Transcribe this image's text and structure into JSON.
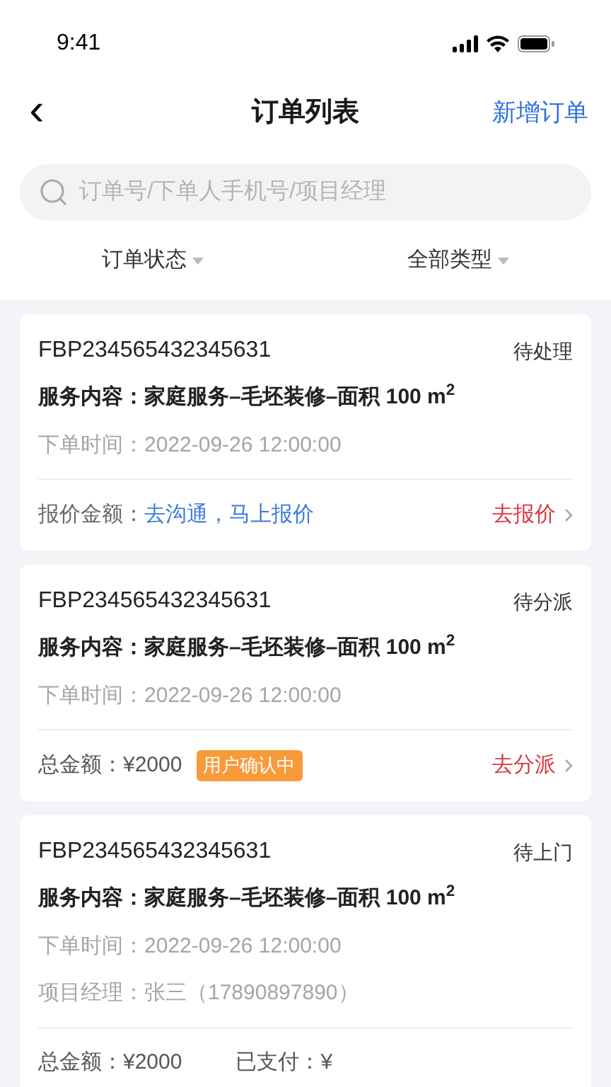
{
  "status_bar": {
    "time": "9:41"
  },
  "nav": {
    "back": "‹",
    "title": "订单列表",
    "action": "新增订单"
  },
  "search": {
    "placeholder": "订单号/下单人手机号/项目经理"
  },
  "filters": [
    {
      "label": "订单状态"
    },
    {
      "label": "全部类型"
    }
  ],
  "orders": [
    {
      "id": "FBP234565432345631",
      "status": "待处理",
      "service": "服务内容：家庭服务–毛坯装修–面积 100 m$^{2}$",
      "details": [
        {
          "label": "下单时间：",
          "value": "2022-09-26 12:00:00"
        }
      ],
      "footer": [
        {
          "kind": "label",
          "text": "报价金额："
        },
        {
          "kind": "link",
          "text": "去沟通，马上报价"
        }
      ],
      "action": "去报价"
    },
    {
      "id": "FBP234565432345631",
      "status": "待分派",
      "service": "服务内容：家庭服务–毛坯装修–面积 100 m$^{2}$",
      "details": [
        {
          "label": "下单时间：",
          "value": "2022-09-26 12:00:00"
        }
      ],
      "footer": [
        {
          "kind": "amount",
          "text": "总金额：¥2000"
        },
        {
          "kind": "badge",
          "text": "用户确认中"
        }
      ],
      "action": "去分派"
    },
    {
      "id": "FBP234565432345631",
      "status": "待上门",
      "service": "服务内容：家庭服务–毛坯装修–面积 100 m$^{2}$",
      "details": [
        {
          "label": "下单时间：",
          "value": "2022-09-26 12:00:00"
        },
        {
          "label": "项目经理：",
          "value": "张三（17890897890）"
        }
      ],
      "footer": [
        {
          "kind": "amount",
          "text": "总金额：¥2000"
        },
        {
          "kind": "amount",
          "text": "已支付：¥"
        }
      ]
    }
  ]
}
